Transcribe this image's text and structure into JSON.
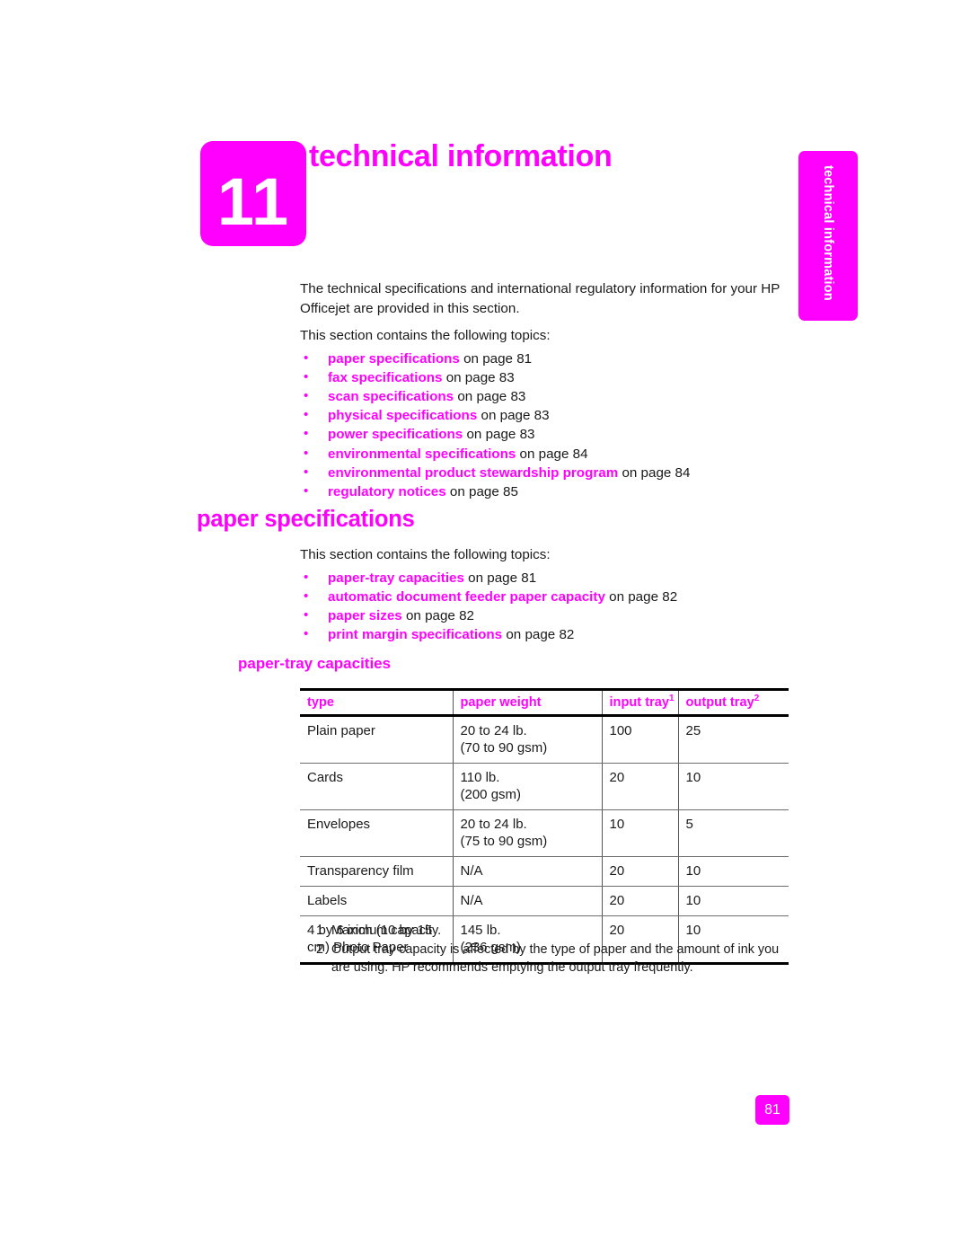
{
  "chapter": {
    "number": "11",
    "title": "technical information",
    "side_tab_label": "technical information"
  },
  "intro": {
    "paragraph": "The technical specifications and international regulatory information for your HP Officejet are provided in this section.",
    "topics_lead": "This section contains the following topics:"
  },
  "chapter_topics": [
    {
      "link": "paper specifications",
      "suffix": " on page 81"
    },
    {
      "link": "fax specifications",
      "suffix": " on page 83"
    },
    {
      "link": "scan specifications",
      "suffix": " on page 83"
    },
    {
      "link": "physical specifications",
      "suffix": " on page 83"
    },
    {
      "link": "power specifications",
      "suffix": " on page 83"
    },
    {
      "link": "environmental specifications",
      "suffix": " on page 84"
    },
    {
      "link": "environmental product stewardship program",
      "suffix": " on page 84"
    },
    {
      "link": "regulatory notices",
      "suffix": " on page 85"
    }
  ],
  "section": {
    "heading": "paper specifications",
    "topics_lead": "This section contains the following topics:",
    "topics": [
      {
        "link": "paper-tray capacities",
        "suffix": " on page 81"
      },
      {
        "link": "automatic document feeder paper capacity",
        "suffix": " on page 82"
      },
      {
        "link": "paper sizes",
        "suffix": " on page 82"
      },
      {
        "link": "print margin specifications",
        "suffix": " on page 82"
      }
    ],
    "sub_heading": "paper-tray capacities"
  },
  "table": {
    "headers": [
      {
        "label": "type",
        "sup": ""
      },
      {
        "label": "paper weight",
        "sup": ""
      },
      {
        "label": "input tray",
        "sup": "1"
      },
      {
        "label": "output tray",
        "sup": "2"
      }
    ],
    "rows": [
      {
        "type": "Plain paper",
        "weight": "20 to 24 lb.\n(70 to 90 gsm)",
        "input": "100",
        "output": "25"
      },
      {
        "type": "Cards",
        "weight": "110 lb.\n(200 gsm)",
        "input": "20",
        "output": "10"
      },
      {
        "type": "Envelopes",
        "weight": "20 to 24 lb.\n(75 to 90 gsm)",
        "input": "10",
        "output": "5"
      },
      {
        "type": "Transparency film",
        "weight": "N/A",
        "input": "20",
        "output": "10"
      },
      {
        "type": "Labels",
        "weight": "N/A",
        "input": "20",
        "output": "10"
      },
      {
        "type": "4 by 6 inch (10 by 15 cm) Photo Paper",
        "weight": "145 lb.\n(236 gsm)",
        "input": "20",
        "output": "10"
      }
    ]
  },
  "footnotes": [
    {
      "num": "1",
      "text": "Maximum capacity."
    },
    {
      "num": "2",
      "text": "Output tray capacity is affected by the type of paper and the amount of ink you are using. HP recommends emptying the output tray frequently."
    }
  ],
  "page_number": "81",
  "colors": {
    "accent": "#ff00ff",
    "text": "#1a1a1a",
    "rule": "#6e6e6e"
  }
}
